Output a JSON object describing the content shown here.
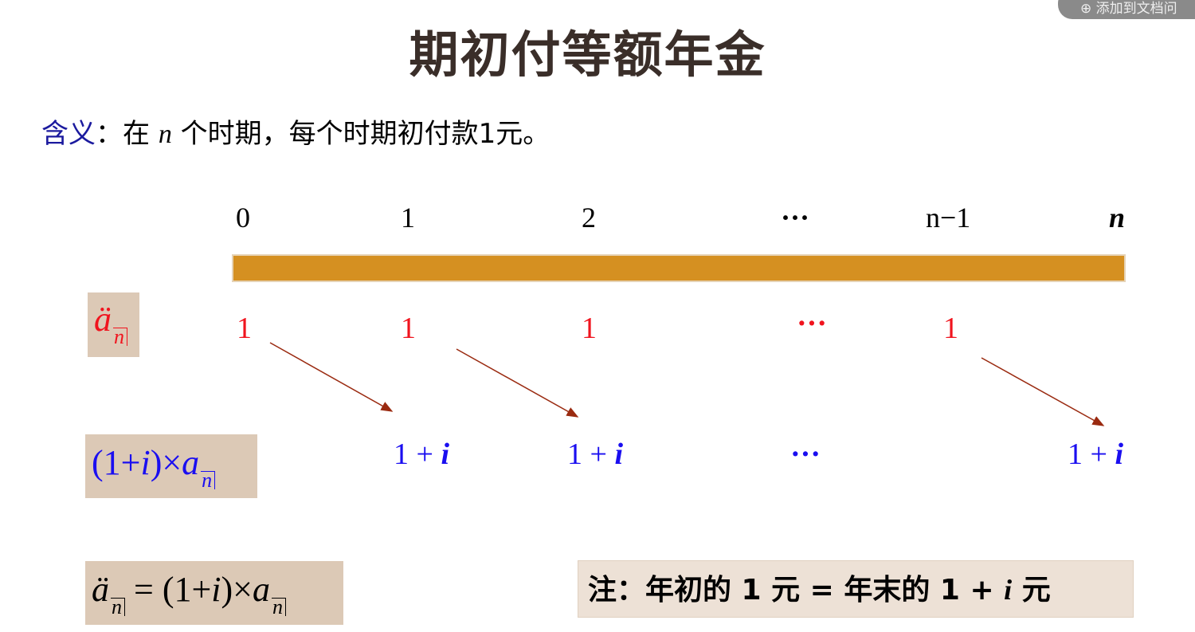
{
  "overlay_button": {
    "label": "⊕ 添加到文档问"
  },
  "title": "期初付等额年金",
  "meaning": {
    "key": "含义",
    "colon": "：",
    "text1": "在 ",
    "var": "n",
    "text2": " 个时期，每个时期初付款1元。"
  },
  "timeline": {
    "ticks": [
      "0",
      "1",
      "2",
      "···",
      "n−1",
      "n"
    ],
    "bar_color": "#d59021"
  },
  "row1": {
    "symbol": "ä",
    "sub": "n",
    "values": [
      "1",
      "1",
      "1",
      "···",
      "1"
    ],
    "color": "#f0141e"
  },
  "row2": {
    "formula_prefix": "(1+",
    "formula_i": "i",
    ")×": ")×",
    "formula_a": "a",
    "sub": "n",
    "values": [
      "1 + ",
      "1 + ",
      "···",
      "1 + "
    ],
    "var": "i",
    "color": "#1a0ef0"
  },
  "row3": {
    "lhs": "ä",
    "sub": "n",
    "mid": " = (1+",
    "i": "i",
    "close": ")×",
    "a": "a",
    "sub2": "n"
  },
  "note": {
    "prefix": "注：年初的 1 元 = 年末的 1 + ",
    "var": "i",
    "suffix": " 元"
  }
}
